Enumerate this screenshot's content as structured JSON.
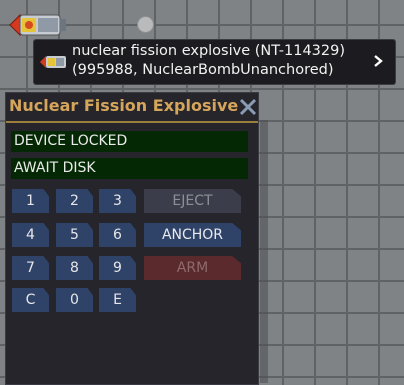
{
  "tooltip": {
    "line1": "nuclear fission explosive (NT-114329)",
    "line2": "(995988, NuclearBombUnanchored)",
    "chevron_icon": "chevron-right-icon"
  },
  "window": {
    "title": "Nuclear Fission Explosive",
    "close_icon": "close-icon",
    "status_line1": "DEVICE LOCKED",
    "status_line2": "AWAIT DISK",
    "keypad": [
      {
        "label": "1"
      },
      {
        "label": "2"
      },
      {
        "label": "3"
      },
      {
        "label": "4"
      },
      {
        "label": "5"
      },
      {
        "label": "6"
      },
      {
        "label": "7"
      },
      {
        "label": "8"
      },
      {
        "label": "9"
      },
      {
        "label": "C"
      },
      {
        "label": "0"
      },
      {
        "label": "E"
      }
    ],
    "actions": {
      "eject": "EJECT",
      "anchor": "ANCHOR",
      "arm": "ARM"
    }
  },
  "colors": {
    "title": "#d4a55a",
    "status_bg": "#032803",
    "key_bg": "#2f4368",
    "arm_bg": "#5b2a2d"
  }
}
